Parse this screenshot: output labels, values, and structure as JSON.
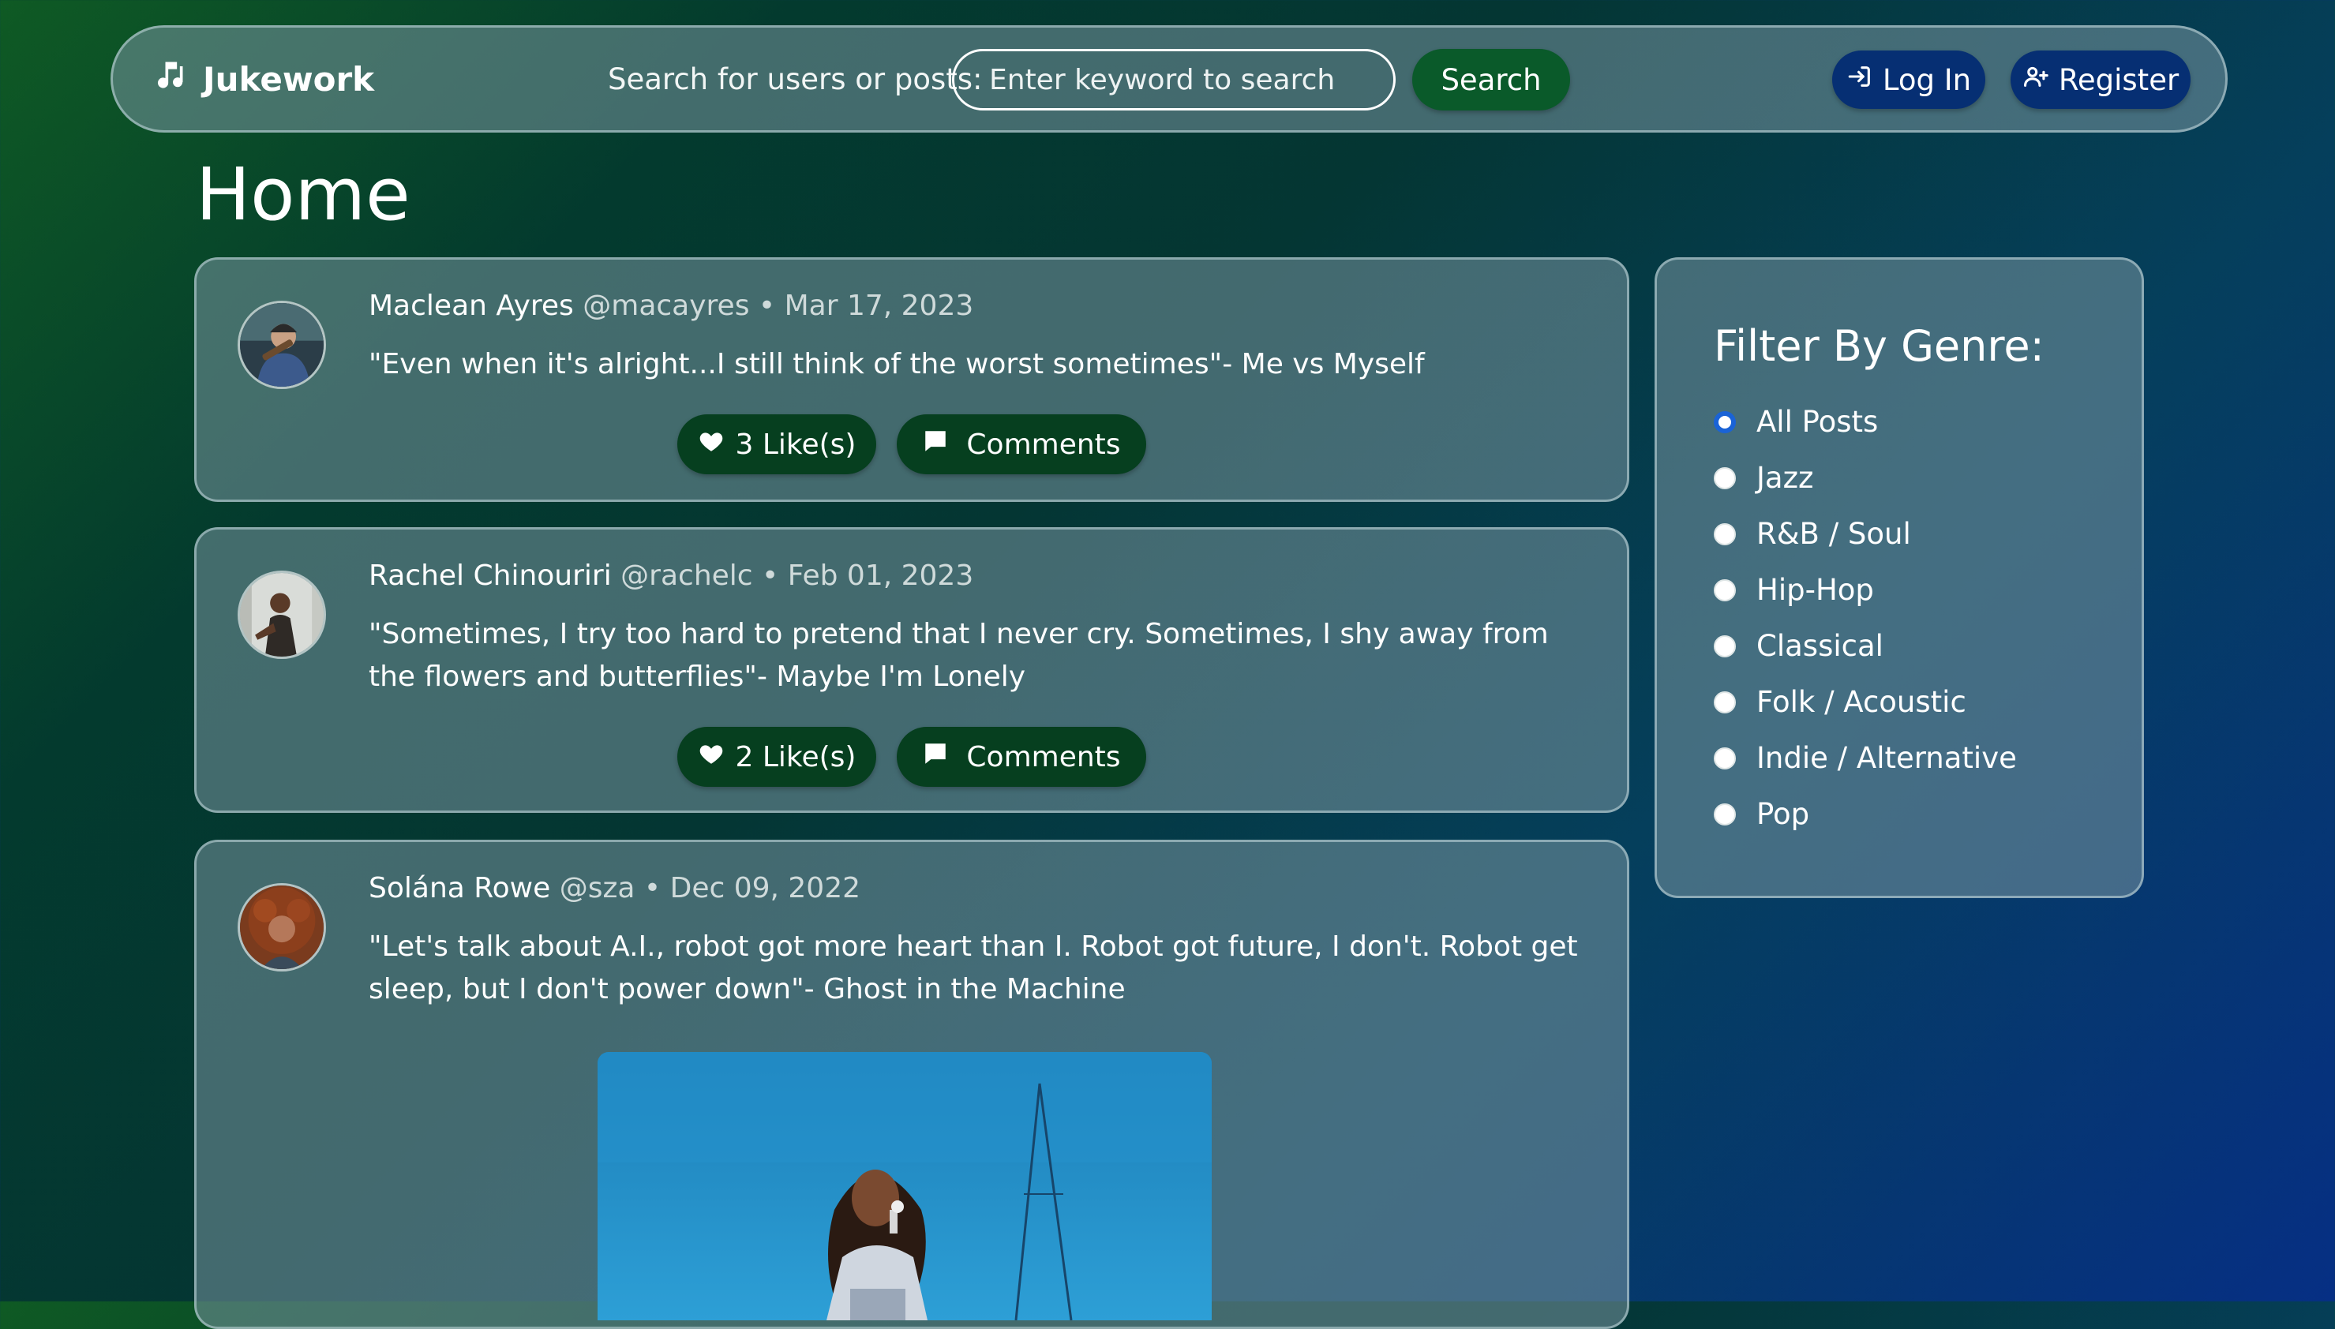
{
  "navbar": {
    "brand": "Jukework",
    "search_label": "Search for users or posts:",
    "search_placeholder": "Enter keyword to search",
    "search_button": "Search",
    "login_button": "Log In",
    "register_button": "Register"
  },
  "page_title": "Home",
  "posts": [
    {
      "author": "Maclean Ayres",
      "handle": "@macayres",
      "separator": "•",
      "date": "Mar 17, 2023",
      "text": "\"Even when it's alright...I still think of the worst sometimes\"- Me vs Myself",
      "likes_label": "3 Like(s)",
      "comments_label": "Comments"
    },
    {
      "author": "Rachel Chinouriri",
      "handle": "@rachelc",
      "separator": "•",
      "date": "Feb 01, 2023",
      "text": "\"Sometimes, I try too hard to pretend that I never cry. Sometimes, I shy away from the flowers and butterflies\"- Maybe I'm Lonely",
      "likes_label": "2 Like(s)",
      "comments_label": "Comments"
    },
    {
      "author": "Solána Rowe",
      "handle": "@sza",
      "separator": "•",
      "date": "Dec 09, 2022",
      "text": "\"Let's talk about A.I., robot got more heart than I. Robot got future, I don't. Robot get sleep, but I don't power down\"- Ghost in the Machine"
    }
  ],
  "filter": {
    "title": "Filter By Genre:",
    "selected": "All Posts",
    "genres": [
      "All Posts",
      "Jazz",
      "R&B / Soul",
      "Hip-Hop",
      "Classical",
      "Folk / Acoustic",
      "Indie / Alternative",
      "Pop"
    ]
  },
  "icons": {
    "brand": "music-note-icon",
    "login": "login-arrow-icon",
    "register": "person-add-icon",
    "like": "heart-icon",
    "comment": "comment-bubble-icon"
  },
  "colors": {
    "search_button": "#0a5a2a",
    "nav_buttons": "#062f73",
    "post_buttons": "#063f1f",
    "radio_selected": "#1a63d6"
  }
}
